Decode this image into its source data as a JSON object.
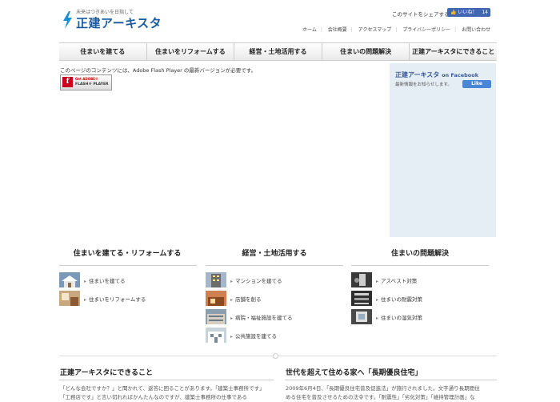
{
  "header": {
    "tagline": "未来はつきあいを日指して",
    "logo_text": "正建アーキスタ",
    "share_label": "このサイトをシェアする",
    "like_label": "いいね！",
    "like_count": "14",
    "topnav": [
      "ホーム",
      "会社概要",
      "アクセスマップ",
      "プライバシーポリシー",
      "お問い合わせ"
    ]
  },
  "mainnav": [
    "住まいを建てる",
    "住まいをリフォームする",
    "経営・土地活用する",
    "住まいの問題解決",
    "正建アーキスタにできること"
  ],
  "flash": {
    "message": "このページのコンテンツには、Adobe Flash Player の最新バージョンが必要です。",
    "btn_line1": "Get ADOBE®",
    "btn_line2": "FLASH® PLAYER",
    "btn_logo": "f"
  },
  "facebook": {
    "title": "正建アーキスタ",
    "title_suffix": "on Facebook",
    "subtitle": "最新情報をお知らせします。",
    "like": "Like"
  },
  "sections": [
    {
      "title": "住まいを建てる・リフォームする",
      "items": [
        "住まいを建てる",
        "住まいをリフォームする"
      ]
    },
    {
      "title": "経営・土地活用する",
      "items": [
        "マンションを建てる",
        "店舗を創る",
        "病院・福祉施設を建てる",
        "公共施設を建てる"
      ]
    },
    {
      "title": "住まいの問題解決",
      "items": [
        "アスベスト対策",
        "住まいの耐震対策",
        "住まいの湿気対策"
      ]
    }
  ],
  "bottom": {
    "left_title": "正建アーキスタにできること",
    "left_lines": [
      "「どんな会社ですか？」と聞かれて、返答に困ることがあります。「建築士事務所です」",
      "「工務店です」と言い切れればかんたんなのですが、建築士事務所の仕事である"
    ],
    "right_title": "世代を超えて住める家へ「長期優良住宅」",
    "right_lines": [
      "2009年6月4日、「長期優良住宅普及促進法」が施行されました。文字通り長期間住",
      "める住宅を普及させるための法令です。「耐震性」「劣化対策」「維持管理計画」な"
    ]
  },
  "colors": {
    "logo_blue": "#1a5aa0",
    "fb_blue": "#3b5998",
    "fb_panel": "#e6eef5"
  }
}
